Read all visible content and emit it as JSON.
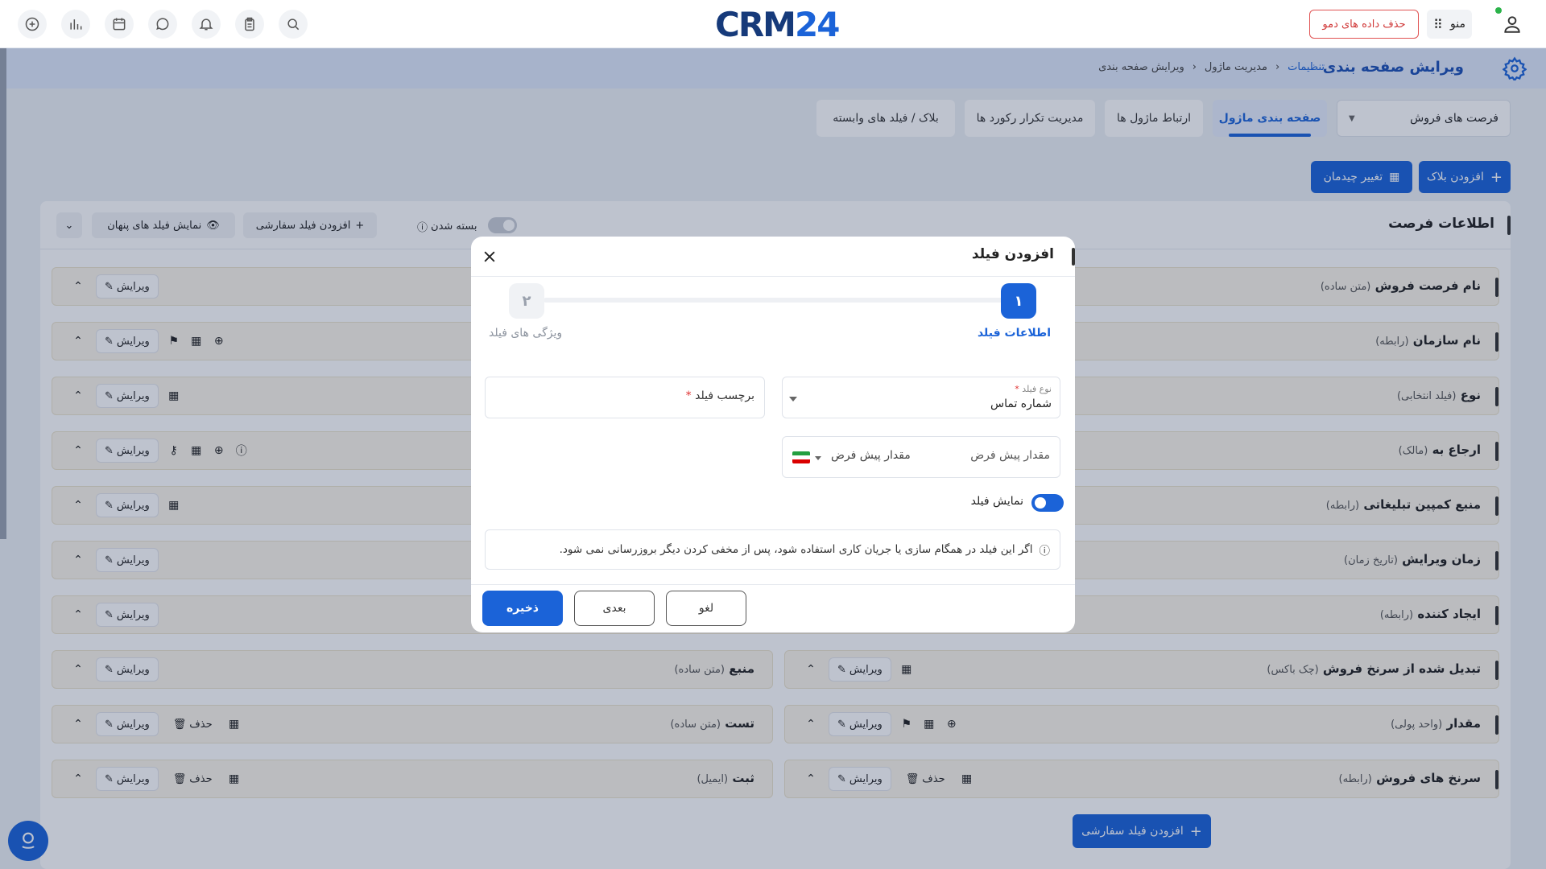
{
  "topbar": {
    "logo_crm": "CRM",
    "logo_num": "24",
    "demo_button": "حذف داده های دمو",
    "menu_label": "منو"
  },
  "header": {
    "title": "ویرایش صفحه بندی",
    "breadcrumb": [
      "تنظیمات",
      "مدیریت ماژول",
      "ویرایش صفحه بندی"
    ]
  },
  "module_select": {
    "value": "فرصت های فروش"
  },
  "tabs": [
    {
      "label": "صفحه بندی ماژول",
      "active": true
    },
    {
      "label": "ارتباط ماژول ها"
    },
    {
      "label": "مدیریت تکرار رکورد ها"
    },
    {
      "label": "بلاک / فیلد های وابسته"
    }
  ],
  "actions": {
    "add_block": "افزودن بلاک",
    "change_layout": "تغییر چیدمان"
  },
  "section": {
    "title": "اطلاعات فرصت",
    "collapse_label": "بسته شدن",
    "add_custom_field": "افزودن فیلد سفارشی",
    "show_hidden": "نمایش فیلد های پنهان",
    "edit_label": "ویرایش",
    "delete_label": "حذف",
    "full_rows": [
      {
        "name": "نام فرصت فروش",
        "type": "(متن ساده)"
      },
      {
        "name": "نام سازمان",
        "type": "(رابطه)"
      },
      {
        "name": "نوع",
        "type": "(فیلد انتخابی)"
      },
      {
        "name": "ارجاع به",
        "type": "(مالک)"
      },
      {
        "name": "منبع کمپین تبلیغاتی",
        "type": "(رابطه)"
      },
      {
        "name": "زمان ویرایش",
        "type": "(تاریخ زمان)"
      },
      {
        "name": "ایجاد کننده",
        "type": "(رابطه)"
      }
    ],
    "right_rows": [
      {
        "name": "تبدیل شده از سرنخ فروش",
        "type": "(چک باکس)"
      },
      {
        "name": "مقدار",
        "type": "(واحد پولی)"
      },
      {
        "name": "سرنخ های فروش",
        "type": "(رابطه)"
      }
    ],
    "left_rows": [
      {
        "name": "منبع",
        "type": "(متن ساده)"
      },
      {
        "name": "تست",
        "type": "(متن ساده)"
      },
      {
        "name": "ثبت",
        "type": "(ایمیل)"
      }
    ],
    "bottom_add_custom": "افزودن فیلد سفارشی"
  },
  "modal": {
    "title": "افزودن فیلد",
    "step1_num": "۱",
    "step1_label": "اطلاعات فیلد",
    "step2_num": "۲",
    "step2_label": "ویژگی های فیلد",
    "field_type_label": "نوع فیلد",
    "field_type_value": "شماره تماس",
    "field_label_placeholder": "برچسب فیلد",
    "default_value_label": "مقدار پیش فرض",
    "default_value_placeholder": "مقدار پیش فرض",
    "show_field_label": "نمایش فیلد",
    "info_text": "اگر این فیلد در همگام سازی یا جریان کاری استفاده شود، پس از مخفی کردن دیگر بروزرسانی نمی شود.",
    "save_button": "ذخیره",
    "next_button": "بعدی",
    "cancel_button": "لغو"
  },
  "colors": {
    "primary": "#1b63d8",
    "danger": "#d03838",
    "row_bg": "#fbf6ea"
  }
}
